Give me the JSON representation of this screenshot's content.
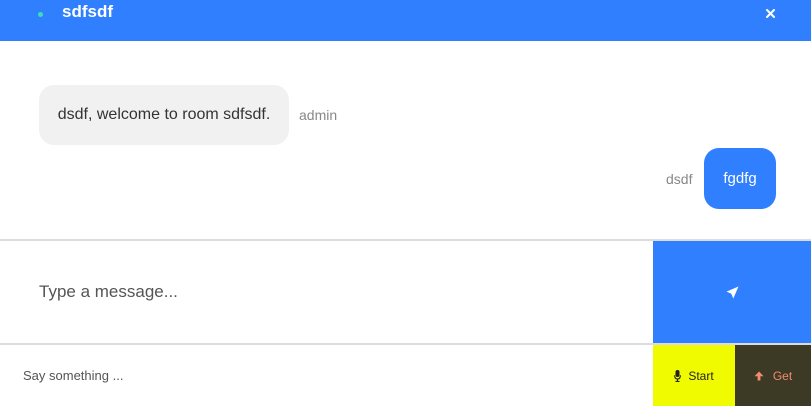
{
  "header": {
    "room_name": "sdfsdf",
    "status_dot_color": "#3ddcb4",
    "close_icon": "close-icon",
    "background_color": "#2f7ffe"
  },
  "messages": [
    {
      "text": "dsdf, welcome to room sdfsdf.",
      "sender": "admin",
      "direction": "received"
    },
    {
      "text": "fgdfg",
      "sender": "dsdf",
      "direction": "sent"
    }
  ],
  "composer": {
    "placeholder": "Type a message...",
    "value": "",
    "send_icon": "send-icon"
  },
  "speech": {
    "placeholder": "Say something ...",
    "value": "",
    "start_label": "Start",
    "start_icon": "microphone-icon",
    "start_color": "#f0fb00",
    "get_label": "Get",
    "get_icon": "arrow-up-icon",
    "get_color": "#3c3a25",
    "get_text_color": "#f08a70"
  }
}
